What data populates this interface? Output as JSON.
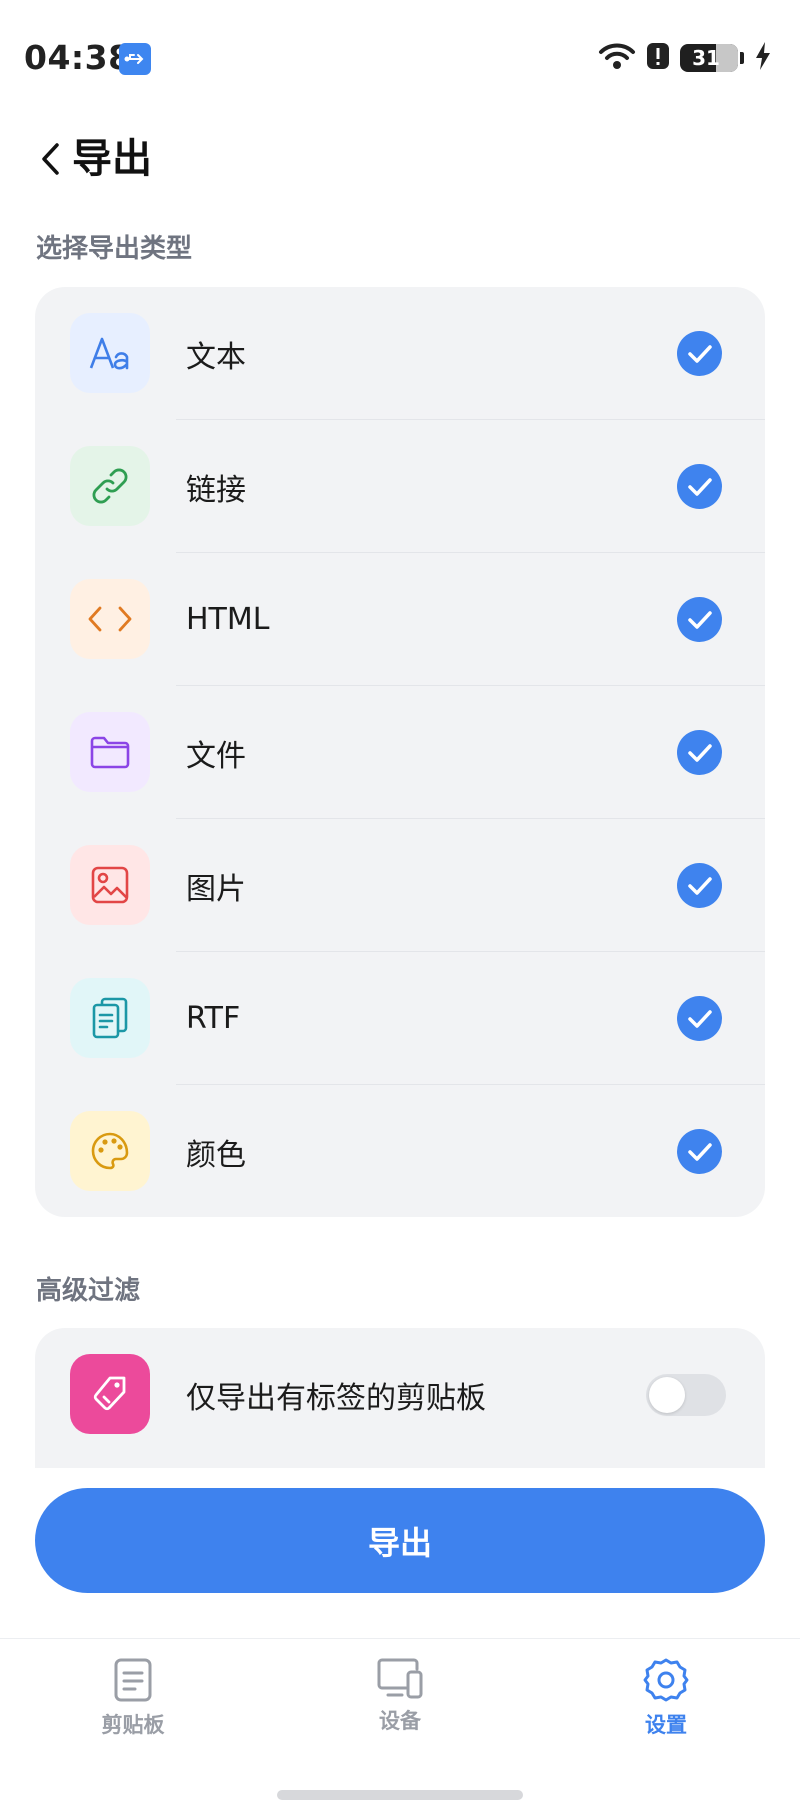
{
  "status_bar": {
    "time": "04:38",
    "battery": "31",
    "icons": [
      "usb-icon",
      "wifi-icon",
      "alert-icon",
      "battery-icon",
      "charging-icon"
    ]
  },
  "header": {
    "title": "导出"
  },
  "types_section": {
    "label": "选择导出类型",
    "items": [
      {
        "label": "文本",
        "icon": "text-icon",
        "tile_color": "#e7efff",
        "icon_color": "#3f7ee8",
        "checked": true
      },
      {
        "label": "链接",
        "icon": "link-icon",
        "tile_color": "#e4f4e8",
        "icon_color": "#2f9e52",
        "checked": true
      },
      {
        "label": "HTML",
        "icon": "code-icon",
        "tile_color": "#fff0e3",
        "icon_color": "#e07a22",
        "checked": true
      },
      {
        "label": "文件",
        "icon": "folder-icon",
        "tile_color": "#f2e9ff",
        "icon_color": "#8b45e6",
        "checked": true
      },
      {
        "label": "图片",
        "icon": "image-icon",
        "tile_color": "#ffe6e6",
        "icon_color": "#e24646",
        "checked": true
      },
      {
        "label": "RTF",
        "icon": "document-icon",
        "tile_color": "#e1f6f8",
        "icon_color": "#1b97a6",
        "checked": true
      },
      {
        "label": "颜色",
        "icon": "palette-icon",
        "tile_color": "#fff4d1",
        "icon_color": "#d99a10",
        "checked": true
      }
    ]
  },
  "filter_section": {
    "label": "高级过滤",
    "items": [
      {
        "label": "仅导出有标签的剪贴板",
        "icon": "tag-icon",
        "tile_color": "#ec4a9b",
        "icon_color": "#ffffff",
        "enabled": false
      }
    ]
  },
  "export_button": {
    "label": "导出"
  },
  "bottom_nav": {
    "items": [
      {
        "label": "剪贴板",
        "icon": "clipboard-icon",
        "active": false
      },
      {
        "label": "设备",
        "icon": "devices-icon",
        "active": false
      },
      {
        "label": "设置",
        "icon": "settings-icon",
        "active": true
      }
    ]
  },
  "colors": {
    "accent": "#3e82ee",
    "card_bg": "#f2f3f5",
    "muted_text": "#6f7480"
  }
}
